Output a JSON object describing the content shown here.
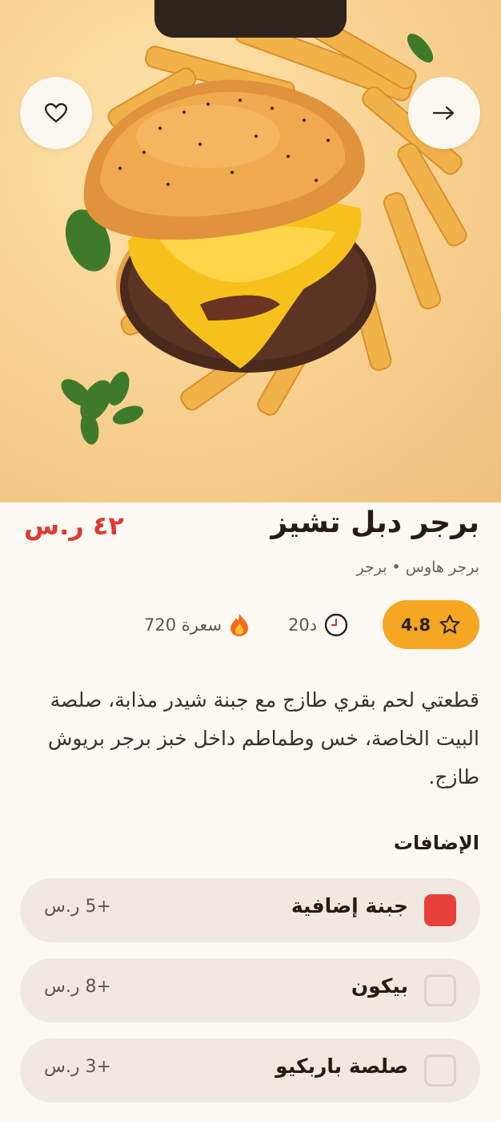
{
  "product": {
    "title": "برجر دبل تشيز",
    "price": "٤٢ ر.س",
    "subtitle": "برجر هاوس • برجر",
    "rating": "4.8",
    "time": "20د",
    "calories": "720 سعرة",
    "description": "قطعتي لحم بقري طازج مع جبنة شيدر مذابة، صلصة البيت الخاصة، خس وطماطم داخل خبز برجر بريوش طازج."
  },
  "addons": {
    "title": "الإضافات",
    "items": [
      {
        "name": "جبنة إضافية",
        "price": "+5 ر.س",
        "checked": true
      },
      {
        "name": "بيكون",
        "price": "+8 ر.س",
        "checked": false
      },
      {
        "name": "صلصة باربكيو",
        "price": "+3 ر.س",
        "checked": false
      }
    ]
  },
  "icons": {
    "favorite": "heart-icon",
    "back": "arrow-right-icon",
    "rating": "star-icon",
    "time": "clock-icon",
    "calories": "fire-icon"
  },
  "colors": {
    "accent_red": "#e0392f",
    "rating_orange": "#f5a623"
  }
}
